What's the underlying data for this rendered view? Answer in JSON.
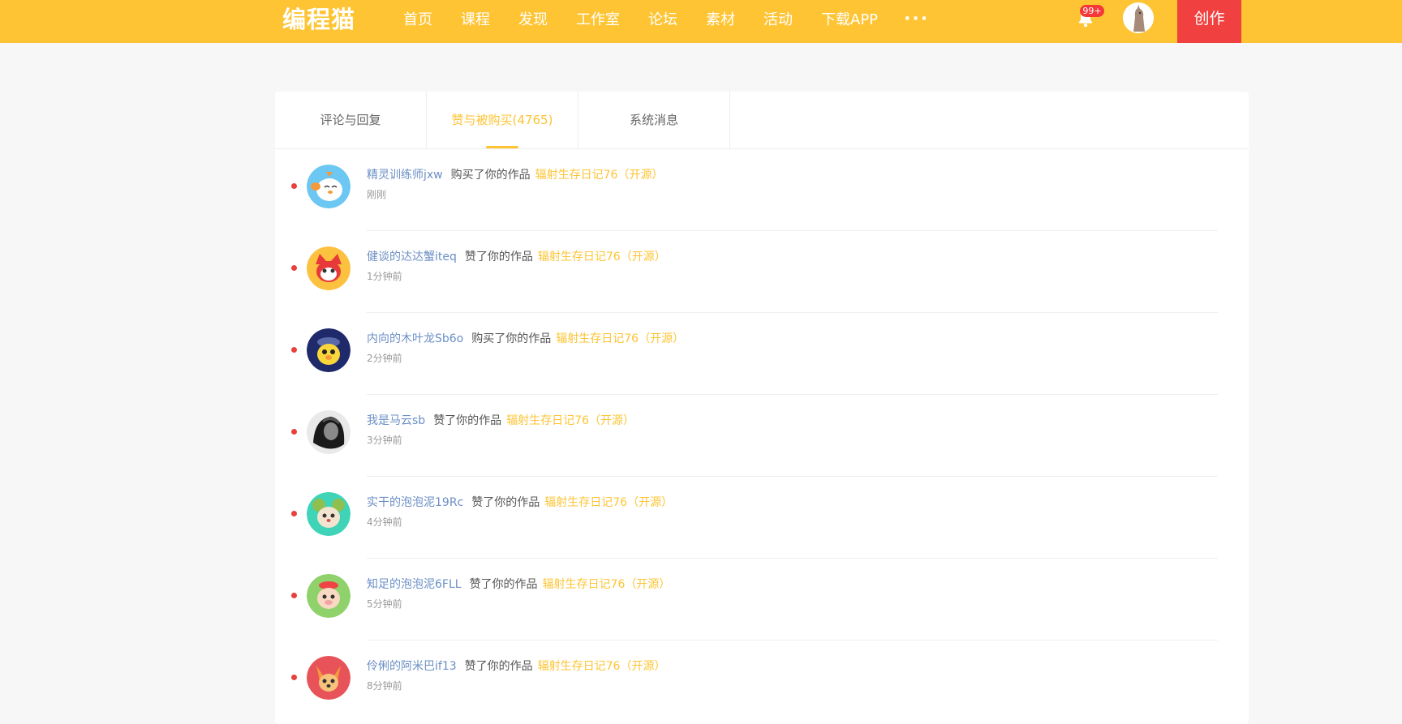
{
  "header": {
    "logo": "编程猫",
    "nav": [
      "首页",
      "课程",
      "发现",
      "工作室",
      "论坛",
      "素材",
      "活动",
      "下载APP"
    ],
    "more": "···",
    "badge": "99+",
    "create_label": "创作",
    "accent": "#fec433",
    "create_color": "#f0403f"
  },
  "tabs": [
    {
      "label": "评论与回复",
      "active": false
    },
    {
      "label": "赞与被购买(4765)",
      "active": true
    },
    {
      "label": "系统消息",
      "active": false
    }
  ],
  "notifications": [
    {
      "user": "精灵训练师jxw",
      "action": "购买了你的作品",
      "work": "辐射生存日记76（开源）",
      "time": "刚刚",
      "avatar": "blue-bird-avatar"
    },
    {
      "user": "健谈的达达蟹iteq",
      "action": "赞了你的作品",
      "work": "辐射生存日记76（开源）",
      "time": "1分钟前",
      "avatar": "red-crab-avatar"
    },
    {
      "user": "内向的木叶龙Sb6o",
      "action": "购买了你的作品",
      "work": "辐射生存日记76（开源）",
      "time": "2分钟前",
      "avatar": "yellow-dragon-avatar"
    },
    {
      "user": "我是马云sb",
      "action": "赞了你的作品",
      "work": "辐射生存日记76（开源）",
      "time": "3分钟前",
      "avatar": "dark-photo-avatar"
    },
    {
      "user": "实干的泡泡泥19Rc",
      "action": "赞了你的作品",
      "work": "辐射生存日记76（开源）",
      "time": "4分钟前",
      "avatar": "green-mouse-avatar"
    },
    {
      "user": "知足的泡泡泥6FLL",
      "action": "赞了你的作品",
      "work": "辐射生存日记76（开源）",
      "time": "5分钟前",
      "avatar": "green-pig-avatar"
    },
    {
      "user": "伶俐的阿米巴if13",
      "action": "赞了你的作品",
      "work": "辐射生存日记76（开源）",
      "time": "8分钟前",
      "avatar": "red-fox-avatar"
    }
  ]
}
